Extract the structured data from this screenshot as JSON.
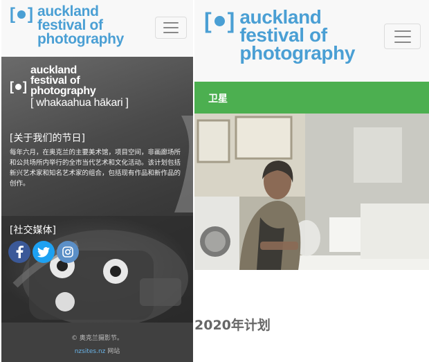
{
  "brand": {
    "line1": "auckland",
    "line2": "festival of",
    "line3": "photography",
    "tagline": "[ whakaahua hākari ]",
    "color": "#4a9fd4"
  },
  "left": {
    "about_title": "[关于我们的节日]",
    "about_text": "每年六月，在奥克兰的主要美术馆，项目空间，非画廊场所和公共场所内举行的全市当代艺术和文化活动。该计划包括新兴艺术家和知名艺术家的组合，包括现有作品和新作品的创作。",
    "social_title": "[社交媒体]",
    "social_icons": [
      "facebook-icon",
      "twitter-icon",
      "instagram-icon"
    ],
    "footer_copy": "© 奥克兰摄影节。",
    "footer_link": "nzsites.nz",
    "footer_suffix": " 网站"
  },
  "right": {
    "section_label": "卫星",
    "heading": "2020年计划",
    "accent": "#4caf50"
  }
}
